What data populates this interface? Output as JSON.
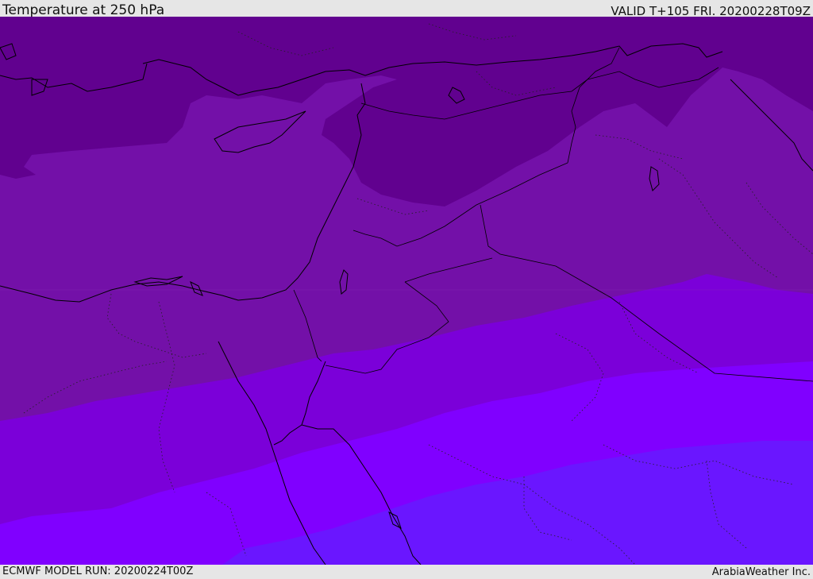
{
  "header": {
    "title": "Temperature at 250 hPa",
    "valid_time": "VALID T+105 FRI. 20200228T09Z"
  },
  "footer": {
    "model_run": "ECMWF MODEL RUN: 20200224T00Z",
    "credit": "ArabiaWeather Inc."
  },
  "map": {
    "field": "temperature_250hPa",
    "palette": {
      "band_1": "#61018f",
      "band_2": "#7310a8",
      "band_3": "#7b00d9",
      "band_4": "#8000ff",
      "band_5": "#6a16ff"
    },
    "line_color": "#000000"
  }
}
